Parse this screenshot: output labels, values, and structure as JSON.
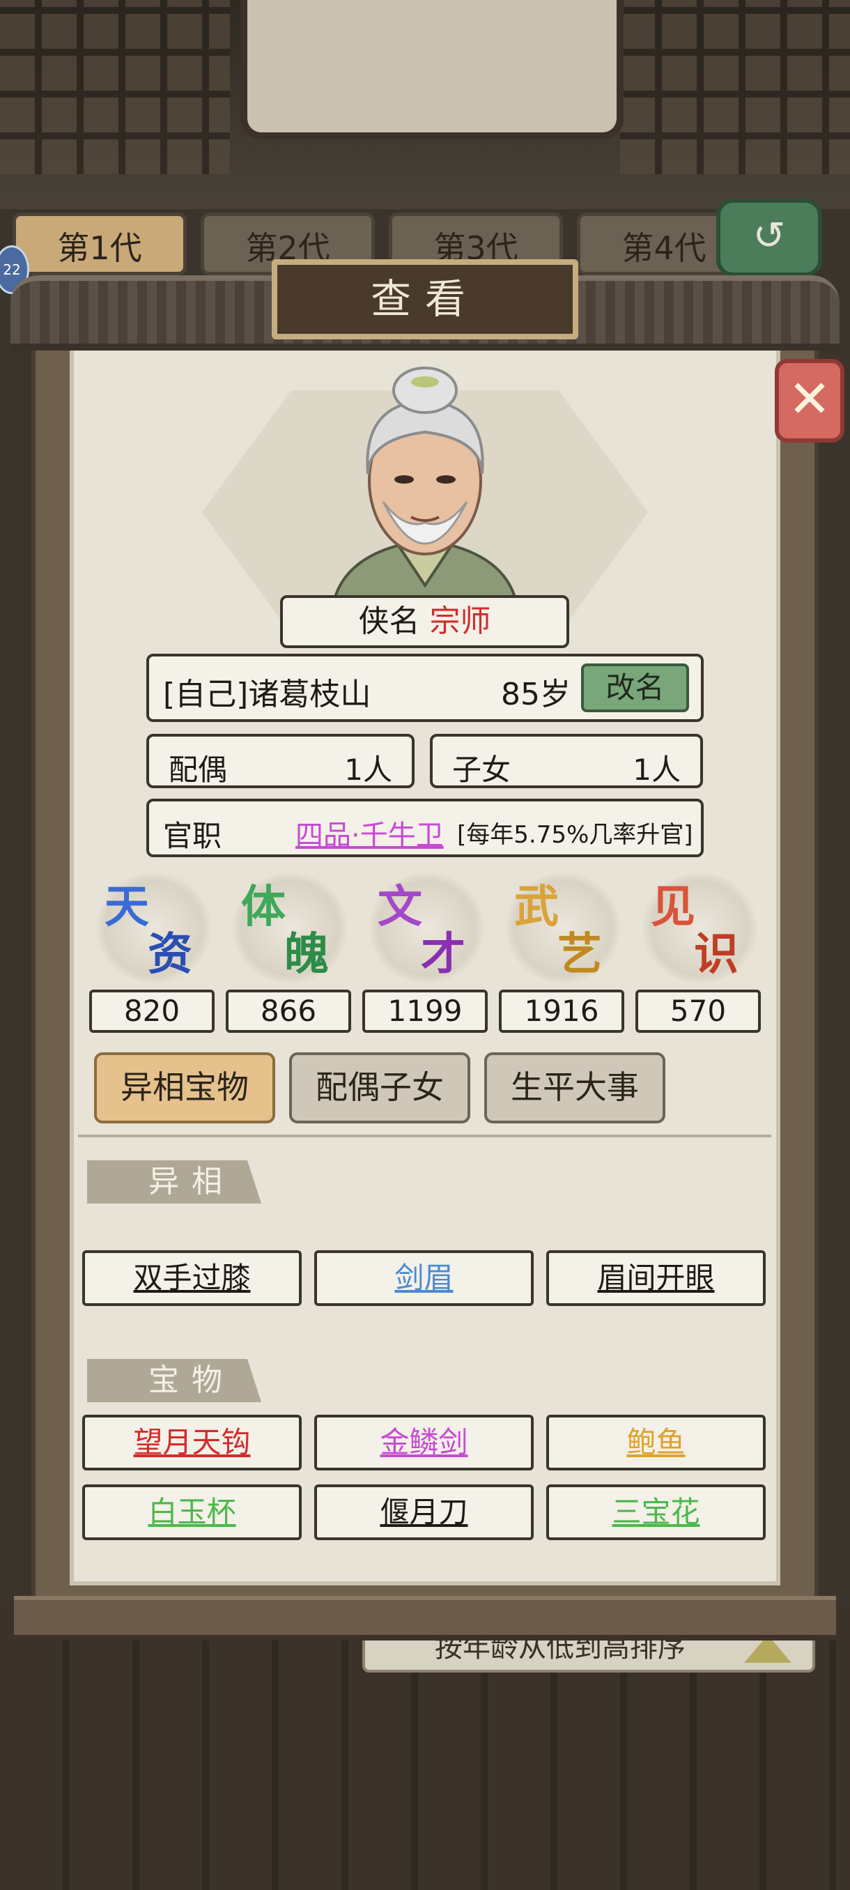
{
  "background": {
    "generation_tabs": [
      "第1代",
      "第2代",
      "第3代",
      "第4代"
    ],
    "level_badge": "22",
    "sort_label": "按年龄从低到高排序"
  },
  "panel": {
    "title": "查看",
    "hero_title_label": "侠名",
    "hero_title_value": "宗师",
    "name": "[自己]诸葛枝山",
    "age": "85岁",
    "rename_label": "改名",
    "spouse_label": "配偶",
    "spouse_value": "1人",
    "children_label": "子女",
    "children_value": "1人",
    "office_label": "官职",
    "office_rank": "四品·千牛卫",
    "office_note": "[每年5.75%几率升官]"
  },
  "attributes": [
    {
      "c1": "天",
      "c2": "资",
      "value": "820",
      "color1": "#3a6bd4",
      "color2": "#2a4fb0"
    },
    {
      "c1": "体",
      "c2": "魄",
      "value": "866",
      "color1": "#3fa85a",
      "color2": "#2d8c48"
    },
    {
      "c1": "文",
      "c2": "才",
      "value": "1199",
      "color1": "#a447c9",
      "color2": "#8a2fb0"
    },
    {
      "c1": "武",
      "c2": "艺",
      "value": "1916",
      "color1": "#d9a33a",
      "color2": "#c08a22"
    },
    {
      "c1": "见",
      "c2": "识",
      "value": "570",
      "color1": "#d9543a",
      "color2": "#c03d25"
    }
  ],
  "tabs": [
    "异相宝物",
    "配偶子女",
    "生平大事"
  ],
  "sections": {
    "traits_title": "异相",
    "treasures_title": "宝物"
  },
  "traits": [
    {
      "label": "双手过膝",
      "color": "#1e1a16"
    },
    {
      "label": "剑眉",
      "color": "#4a8ad4"
    },
    {
      "label": "眉间开眼",
      "color": "#1e1a16"
    }
  ],
  "treasures": [
    {
      "label": "望月天钩",
      "color": "#d22c2c"
    },
    {
      "label": "金鳞剑",
      "color": "#c74ad4"
    },
    {
      "label": "鲍鱼",
      "color": "#e0a22a"
    },
    {
      "label": "白玉杯",
      "color": "#4cb84c"
    },
    {
      "label": "偃月刀",
      "color": "#1e1a16"
    },
    {
      "label": "三宝花",
      "color": "#4cb84c"
    }
  ],
  "icons": {
    "close": "close-icon",
    "back": "back-arrow-icon",
    "sort": "sort-triangle-icon"
  }
}
